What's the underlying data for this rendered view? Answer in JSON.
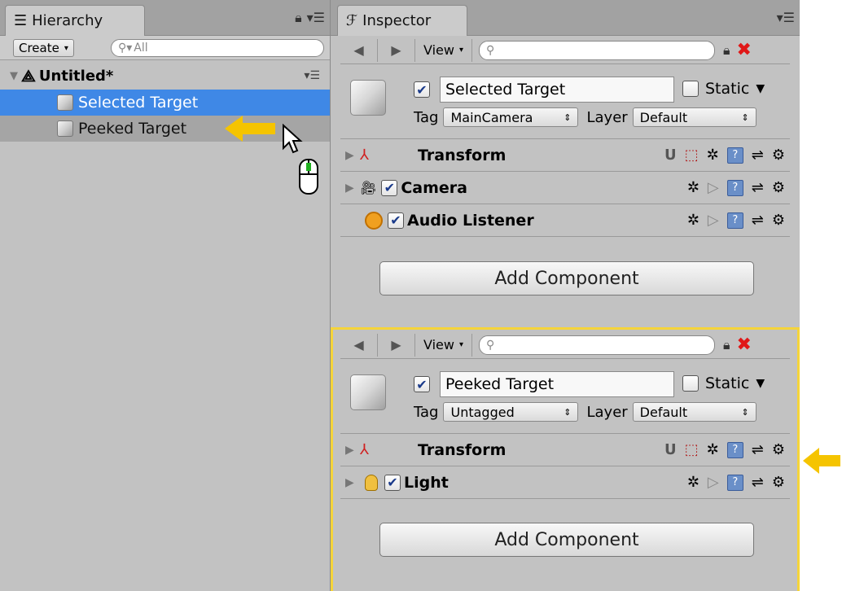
{
  "hierarchy": {
    "tab_label": "Hierarchy",
    "create_label": "Create",
    "search_placeholder": "All",
    "scene_name": "Untitled*",
    "items": [
      {
        "label": "Selected Target",
        "state": "selected"
      },
      {
        "label": "Peeked Target",
        "state": "peeked"
      }
    ]
  },
  "inspector": {
    "tab_label": "Inspector",
    "view_label": "View",
    "static_label": "Static",
    "tag_label": "Tag",
    "layer_label": "Layer",
    "add_component_label": "Add Component",
    "selected": {
      "name": "Selected Target",
      "tag": "MainCamera",
      "layer": "Default",
      "components": [
        {
          "name": "Transform",
          "has_checkbox": false,
          "icon": "transform-icon"
        },
        {
          "name": "Camera",
          "has_checkbox": true,
          "icon": "camera-icon"
        },
        {
          "name": "Audio Listener",
          "has_checkbox": true,
          "icon": "audio-listener-icon"
        }
      ]
    },
    "peeked": {
      "name": "Peeked Target",
      "tag": "Untagged",
      "layer": "Default",
      "components": [
        {
          "name": "Transform",
          "has_checkbox": false,
          "icon": "transform-icon"
        },
        {
          "name": "Light",
          "has_checkbox": true,
          "icon": "light-icon"
        }
      ]
    }
  },
  "colors": {
    "selection_blue": "#3f88e6",
    "highlight_yellow": "#f5c400",
    "close_red": "#e01818"
  }
}
